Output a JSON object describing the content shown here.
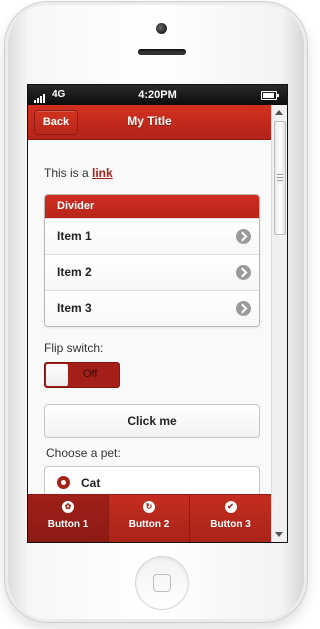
{
  "status": {
    "network": "4G",
    "time": "4:20PM"
  },
  "header": {
    "back_label": "Back",
    "title": "My Title"
  },
  "content": {
    "intro_text": "This is a ",
    "link_text": "link",
    "list": {
      "divider": "Divider",
      "items": [
        "Item 1",
        "Item 2",
        "Item 3"
      ]
    },
    "flip": {
      "label": "Flip switch:",
      "value": "Off"
    },
    "button_label": "Click me",
    "pet": {
      "label": "Choose a pet:",
      "options": [
        "Cat"
      ],
      "selected": "Cat"
    }
  },
  "footer": {
    "buttons": [
      {
        "label": "Button 1",
        "icon": "gear-icon",
        "glyph": "✿",
        "active": true
      },
      {
        "label": "Button 2",
        "icon": "refresh-icon",
        "glyph": "↻",
        "active": false
      },
      {
        "label": "Button 3",
        "icon": "check-icon",
        "glyph": "✔",
        "active": false
      }
    ]
  },
  "colors": {
    "accent": "#b9261a",
    "accent_dark": "#8c1b14"
  }
}
